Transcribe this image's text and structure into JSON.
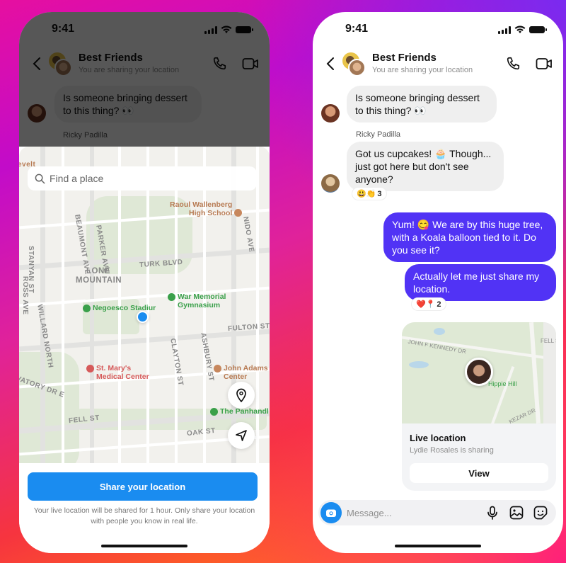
{
  "colors": {
    "accent_blue": "#1a8cf0",
    "my_bubble": "#5133f5",
    "their_bubble": "#efefef"
  },
  "status_bar": {
    "time": "9:41"
  },
  "chat_header": {
    "title": "Best Friends",
    "subtitle": "You are sharing your location",
    "icons": [
      "back-chevron-icon",
      "phone-icon",
      "video-camera-icon"
    ]
  },
  "left_phone": {
    "messages": [
      {
        "sender": "them",
        "text": "Is someone bringing dessert to this thing? 👀"
      }
    ],
    "next_sender_label": "Ricky Padilla",
    "map": {
      "search_placeholder": "Find a place",
      "street_labels": [
        "STANYAN ST",
        "BEAUMONT AVE",
        "PARKER AVE",
        "ROSS AVE",
        "TURK BLVD",
        "NIDO AVE",
        "FULTON ST",
        "CLAYTON ST",
        "ASHBURY ST",
        "FELL ST",
        "OAK ST",
        "WILLARD NORTH",
        "VATORY DR E"
      ],
      "area_label": "LONE MOUNTAIN",
      "edge_label": "evelt",
      "pois": [
        {
          "name": "Raoul Wallenberg High School",
          "line1": "Raoul Wallenberg",
          "line2": "High School",
          "type": "school"
        },
        {
          "name": "War Memorial Gymnasium",
          "line1": "War Memorial",
          "line2": "Gymnasium",
          "type": "park"
        },
        {
          "name": "Negoesco Stadium",
          "line1": "Negoesco Stadiur",
          "line2": "",
          "type": "park"
        },
        {
          "name": "St. Mary's Medical Center",
          "line1": "St. Mary's",
          "line2": "Medical Center",
          "type": "hospital"
        },
        {
          "name": "John Adams Center",
          "line1": "John Adams",
          "line2": "Center",
          "type": "school"
        },
        {
          "name": "The Panhandle",
          "line1": "The Panhandl",
          "line2": "",
          "type": "park"
        }
      ],
      "buttons": [
        "location-pin-icon",
        "navigation-arrow-icon"
      ]
    },
    "share_button_label": "Share your location",
    "disclaimer": "Your live location will be shared for 1 hour. Only share your location with people you know in real life."
  },
  "right_phone": {
    "messages": [
      {
        "sender": "them",
        "text": "Is someone bringing dessert to this thing? 👀"
      },
      {
        "sender_label": "Ricky Padilla",
        "sender": "them",
        "text": "Got us cupcakes! 🧁 Though... just got here but don't see anyone?",
        "reactions": {
          "emojis": "😃👏",
          "count": "3"
        }
      },
      {
        "sender": "me",
        "text": "Yum! 😋 We are by this huge tree, with a Koala balloon tied to it. Do you see it?"
      },
      {
        "sender": "me",
        "text": "Actually let me just share my location.",
        "reactions": {
          "emojis": "❤️📍",
          "count": "2"
        }
      }
    ],
    "live_location": {
      "title": "Live location",
      "subtitle": "Lydie Rosales is sharing",
      "view_label": "View",
      "map_labels": {
        "place": "Hippie Hill",
        "road1": "JOHN F KENNEDY DR",
        "road2": "KEZAR DR",
        "road3": "FELL ST"
      }
    },
    "composer": {
      "placeholder": "Message...",
      "icons": [
        "camera-icon",
        "microphone-icon",
        "gallery-icon",
        "sticker-icon"
      ]
    }
  }
}
